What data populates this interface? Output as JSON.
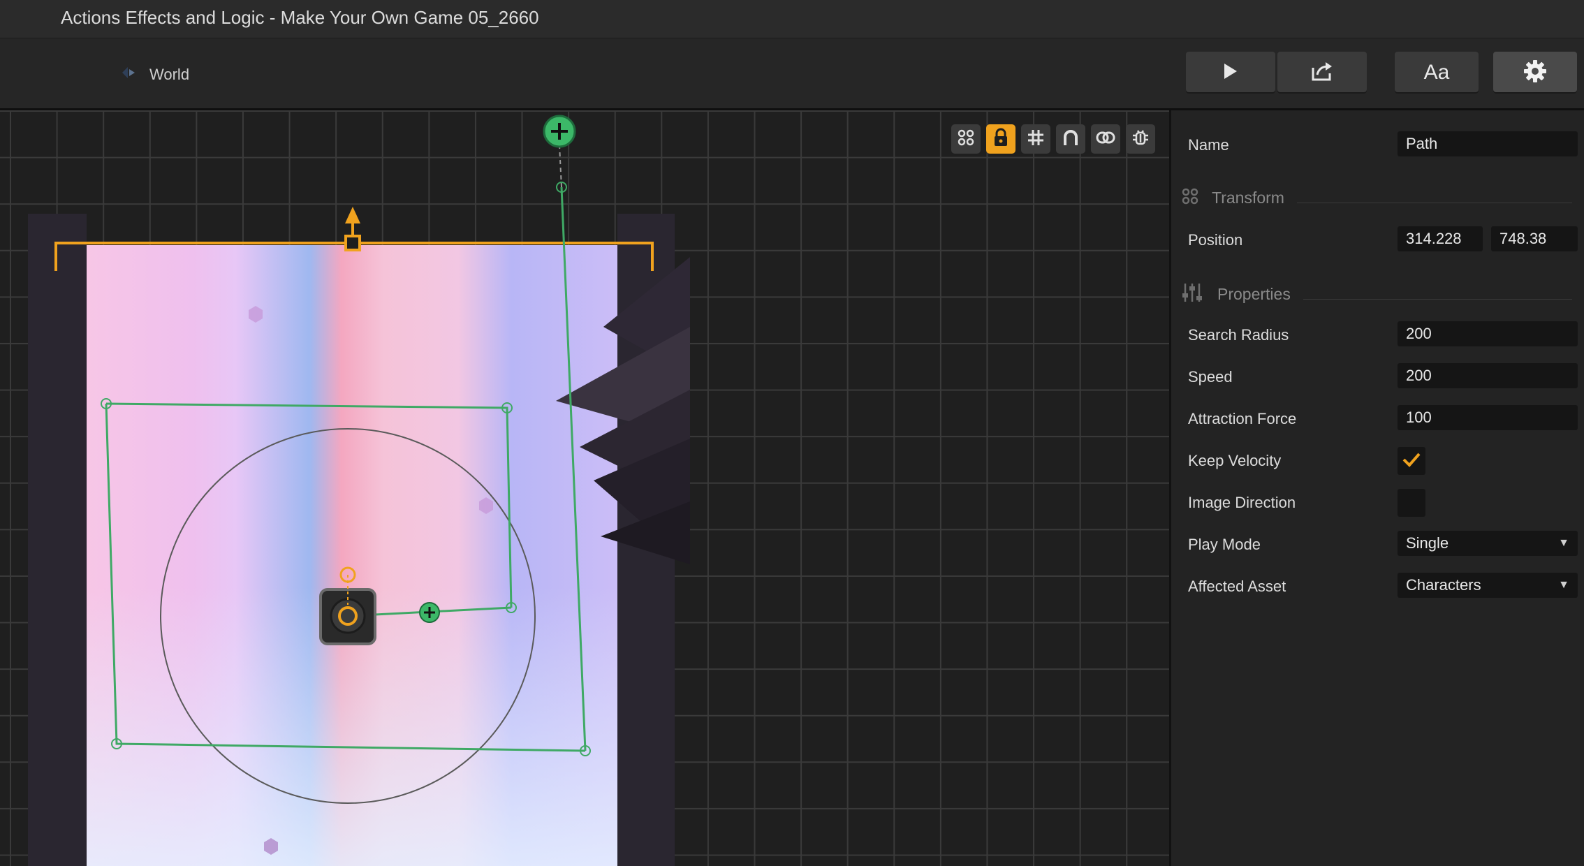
{
  "window": {
    "title": "Actions Effects and Logic - Make Your Own Game 05_2660"
  },
  "toolbar": {
    "breadcrumb": "World",
    "buttons": [
      {
        "id": "play",
        "icon": "play-icon"
      },
      {
        "id": "share",
        "icon": "share-icon"
      },
      {
        "id": "font",
        "label": "Aa",
        "icon": "font-icon"
      },
      {
        "id": "settings",
        "icon": "gear-icon"
      }
    ]
  },
  "viewport": {
    "tools": [
      "transform-icon",
      "lock-icon",
      "grid-icon",
      "magnet-icon",
      "link-icon",
      "debug-icon"
    ],
    "active_tool": "lock-icon",
    "accent_color": "#f0a21e",
    "path_color": "#3fa965"
  },
  "inspector": {
    "name_label": "Name",
    "name_value": "Path",
    "transform_section": "Transform",
    "position_label": "Position",
    "position_x": "314.228",
    "position_y": "748.38",
    "properties_section": "Properties",
    "search_radius_label": "Search Radius",
    "search_radius_value": "200",
    "speed_label": "Speed",
    "speed_value": "200",
    "attraction_force_label": "Attraction Force",
    "attraction_force_value": "100",
    "keep_velocity_label": "Keep Velocity",
    "keep_velocity_checked": true,
    "image_direction_label": "Image Direction",
    "image_direction_checked": false,
    "play_mode_label": "Play Mode",
    "play_mode_value": "Single",
    "affected_asset_label": "Affected Asset",
    "affected_asset_value": "Characters"
  }
}
